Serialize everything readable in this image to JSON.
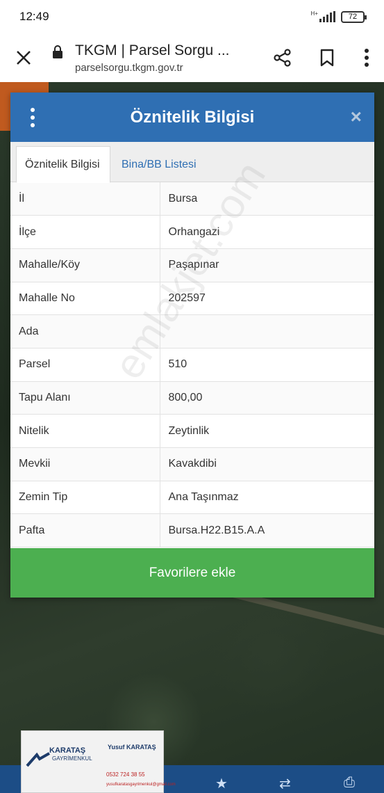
{
  "status_bar": {
    "time": "12:49",
    "battery": "72",
    "network": "H+"
  },
  "browser": {
    "title": "TKGM | Parsel Sorgu ...",
    "url": "parselsorgu.tkgm.gov.tr",
    "icons": [
      "close-icon",
      "lock-icon",
      "share-icon",
      "bookmark-icon",
      "more-vert-icon"
    ]
  },
  "panel": {
    "title": "Öznitelik Bilgisi",
    "close_symbol": "×",
    "tabs": [
      {
        "label": "Öznitelik Bilgisi",
        "active": true
      },
      {
        "label": "Bina/BB Listesi",
        "active": false
      }
    ],
    "rows": [
      {
        "key": "İl",
        "value": "Bursa"
      },
      {
        "key": "İlçe",
        "value": "Orhangazi"
      },
      {
        "key": "Mahalle/Köy",
        "value": "Paşapınar"
      },
      {
        "key": "Mahalle No",
        "value": "202597"
      },
      {
        "key": "Ada",
        "value": ""
      },
      {
        "key": "Parsel",
        "value": "510"
      },
      {
        "key": "Tapu Alanı",
        "value": "800,00"
      },
      {
        "key": "Nitelik",
        "value": "Zeytinlik"
      },
      {
        "key": "Mevkii",
        "value": "Kavakdibi"
      },
      {
        "key": "Zemin Tip",
        "value": "Ana Taşınmaz"
      },
      {
        "key": "Pafta",
        "value": "Bursa.H22.B15.A.A"
      }
    ],
    "favorite_button": "Favorilere ekle"
  },
  "watermark": "emlakjet.com",
  "card": {
    "brand": "KARATAŞ",
    "sub": "GAYRİMENKUL",
    "name": "Yusuf KARATAŞ",
    "phone": "0532 724 38 55",
    "email": "yusufkaratasgayrimenkul@gmail.com"
  },
  "colors": {
    "header": "#2f6fb3",
    "favorite": "#4caf50",
    "bottom_bar": "#1c4d86"
  }
}
